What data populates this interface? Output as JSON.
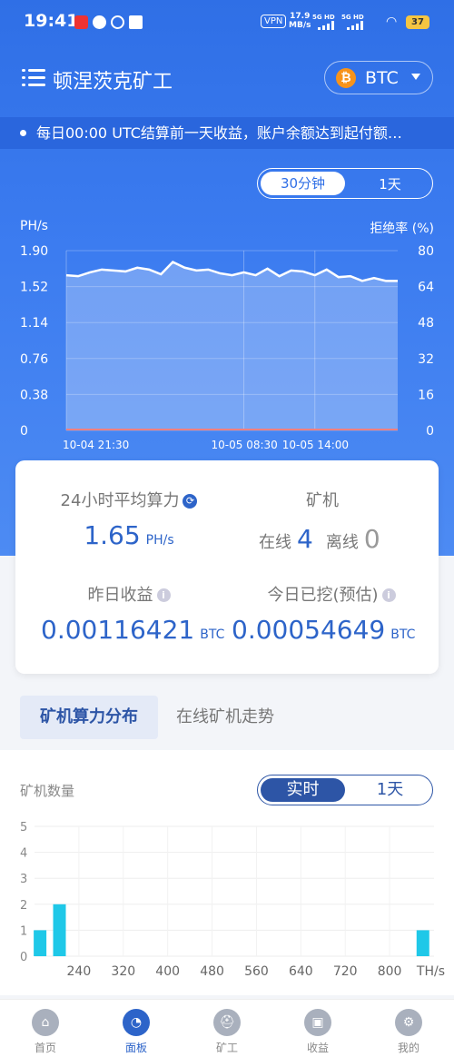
{
  "status_bar": {
    "time": "19:41",
    "vpn": "VPN",
    "speed_value": "17.9",
    "speed_unit": "MB/s",
    "signal1": "5G HD",
    "signal2": "5G HD",
    "battery": "37"
  },
  "header": {
    "title": "顿涅茨克矿工",
    "coin": "BTC",
    "coin_icon": "bitcoin-icon",
    "menu_icon": "menu-icon"
  },
  "notice": "每日00:00 UTC结算前一天收益，账户余额达到起付额…",
  "hashrate_chart": {
    "range_options": [
      "30分钟",
      "1天"
    ],
    "selected_range": "30分钟"
  },
  "chart_data": [
    {
      "type": "area",
      "ylabel": "PH/s",
      "y2label": "拒绝率 (%)",
      "y_ticks": [
        "1.90",
        "1.52",
        "1.14",
        "0.76",
        "0.38",
        "0"
      ],
      "y2_ticks": [
        "80",
        "64",
        "48",
        "32",
        "16",
        "0"
      ],
      "ylim": [
        0,
        1.9
      ],
      "y2lim": [
        0,
        80
      ],
      "x_tick_labels": [
        "10-04 21:30",
        "10-05 08:30",
        "10-05 14:00"
      ],
      "x_tick_positions": [
        0,
        15,
        21
      ],
      "grid": true,
      "series": [
        {
          "values": [
            1.64,
            1.63,
            1.67,
            1.7,
            1.69,
            1.68,
            1.72,
            1.7,
            1.65,
            1.78,
            1.72,
            1.69,
            1.7,
            1.66,
            1.64,
            1.67,
            1.64,
            1.71,
            1.63,
            1.69,
            1.68,
            1.64,
            1.7,
            1.62,
            1.63,
            1.58,
            1.61,
            1.58,
            1.58
          ],
          "color": "#ffffff"
        },
        {
          "values": [
            0.4,
            0.4,
            0.4,
            0.4,
            0.4,
            0.4,
            0.4,
            0.4,
            0.4,
            0.4,
            0.4,
            0.4,
            0.4,
            0.4,
            0.4,
            0.4,
            0.4,
            0.4,
            0.4,
            0.4,
            0.4,
            0.4,
            0.4,
            0.4,
            0.4,
            0.4,
            0.4,
            0.4,
            0.4
          ],
          "color": "#f08080"
        }
      ]
    },
    {
      "type": "bar",
      "ylabel": "矿机数量",
      "y_ticks": [
        "5",
        "4",
        "3",
        "2",
        "1",
        "0"
      ],
      "ylim": [
        0,
        5
      ],
      "x_tick_labels": [
        "240",
        "320",
        "400",
        "480",
        "560",
        "640",
        "720",
        "800"
      ],
      "x_unit": "TH/s",
      "x_range": [
        160,
        880
      ],
      "grid": true,
      "bars": [
        {
          "x": 170,
          "value": 1
        },
        {
          "x": 205,
          "value": 2
        },
        {
          "x": 860,
          "value": 1
        }
      ],
      "color": "#1fc8e8"
    }
  ],
  "stats": {
    "avg_label": "24小时平均算力",
    "avg_value": "1.65",
    "avg_unit": "PH/s",
    "miners_label": "矿机",
    "online_label": "在线",
    "online_count": "4",
    "offline_label": "离线",
    "offline_count": "0",
    "yesterday_label": "昨日收益",
    "yesterday_value": "0.00116421",
    "yesterday_unit": "BTC",
    "today_label": "今日已挖(预估)",
    "today_value": "0.00054649",
    "today_unit": "BTC"
  },
  "tabs": {
    "distribution": "矿机算力分布",
    "trend": "在线矿机走势"
  },
  "distribution": {
    "range_options": [
      "实时",
      "1天"
    ],
    "selected_range": "实时"
  },
  "bottom_nav": [
    {
      "label": "首页",
      "icon": "home-icon",
      "active": false
    },
    {
      "label": "面板",
      "icon": "dashboard-icon",
      "active": true
    },
    {
      "label": "矿工",
      "icon": "miner-helmet-icon",
      "active": false
    },
    {
      "label": "收益",
      "icon": "wallet-icon",
      "active": false
    },
    {
      "label": "我的",
      "icon": "profile-gear-icon",
      "active": false
    }
  ]
}
